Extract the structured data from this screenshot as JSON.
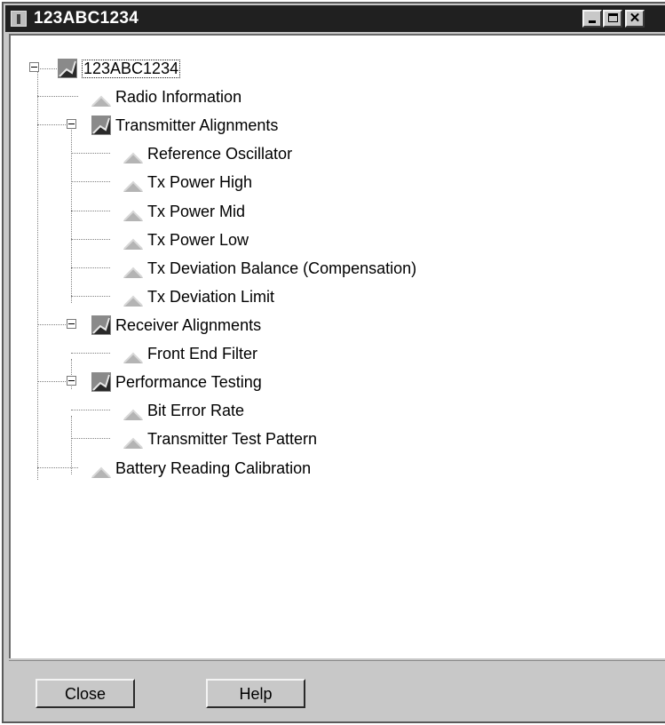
{
  "window": {
    "title": "123ABC1234",
    "controls": {
      "minimize": "minimize",
      "maximize": "maximize",
      "close": "close"
    }
  },
  "tree": {
    "root": {
      "label": "123ABC1234",
      "selected": true,
      "expanded": true
    },
    "items": [
      {
        "label": "Radio Information",
        "depth": 1,
        "type": "leaf"
      },
      {
        "label": "Transmitter Alignments",
        "depth": 1,
        "type": "folder",
        "expanded": true
      },
      {
        "label": "Reference Oscillator",
        "depth": 2,
        "type": "leaf"
      },
      {
        "label": "Tx Power High",
        "depth": 2,
        "type": "leaf"
      },
      {
        "label": "Tx Power Mid",
        "depth": 2,
        "type": "leaf"
      },
      {
        "label": "Tx Power Low",
        "depth": 2,
        "type": "leaf"
      },
      {
        "label": "Tx Deviation Balance (Compensation)",
        "depth": 2,
        "type": "leaf"
      },
      {
        "label": "Tx Deviation Limit",
        "depth": 2,
        "type": "leaf"
      },
      {
        "label": "Receiver Alignments",
        "depth": 1,
        "type": "folder",
        "expanded": true
      },
      {
        "label": "Front End Filter",
        "depth": 2,
        "type": "leaf"
      },
      {
        "label": "Performance Testing",
        "depth": 1,
        "type": "folder",
        "expanded": true
      },
      {
        "label": "Bit Error Rate",
        "depth": 2,
        "type": "leaf"
      },
      {
        "label": "Transmitter Test Pattern",
        "depth": 2,
        "type": "leaf"
      },
      {
        "label": "Battery Reading Calibration",
        "depth": 1,
        "type": "leaf"
      }
    ]
  },
  "footer": {
    "close_label": "Close",
    "help_label": "Help"
  },
  "colors": {
    "titlebar": "#202020",
    "face": "#c8c8c8",
    "tree_bg": "#ffffff"
  },
  "icons": {
    "node": "alignment-node-icon",
    "leaf": "alignment-leaf-icon"
  }
}
